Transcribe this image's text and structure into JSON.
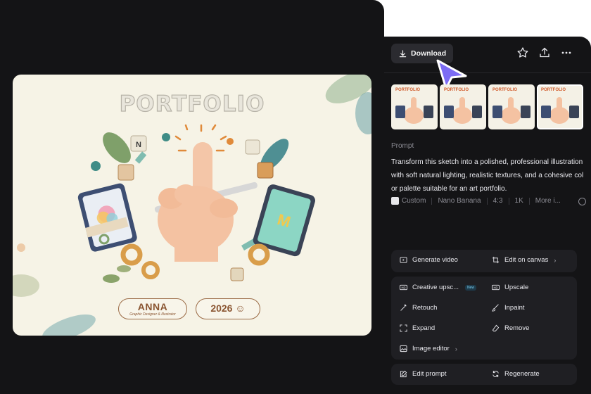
{
  "preview": {
    "title": "PORTFOLIO",
    "name": "ANNA",
    "subtitle": "Graphic Designer & Illustrator",
    "year": "2026"
  },
  "toolbar": {
    "download_label": "Download"
  },
  "thumbnails": [
    {
      "label": "PORTFOLIO"
    },
    {
      "label": "PORTFOLIO"
    },
    {
      "label": "PORTFOLIO"
    },
    {
      "label": "PORTFOLIO"
    }
  ],
  "prompt": {
    "label": "Prompt",
    "text": "Transform this sketch into a polished, professional illustration with soft natural lighting, realistic textures, and a cohesive color palette suitable for an art portfolio.",
    "style": "Custom",
    "model": "Nano Banana",
    "ratio": "4:3",
    "resolution": "1K",
    "more": "More i..."
  },
  "actions": {
    "generate_video": "Generate video",
    "edit_on_canvas": "Edit on canvas",
    "creative_upscale": "Creative upsc...",
    "new_badge": "New",
    "upscale": "Upscale",
    "retouch": "Retouch",
    "inpaint": "Inpaint",
    "expand": "Expand",
    "remove": "Remove",
    "image_editor": "Image editor",
    "edit_prompt": "Edit prompt",
    "regenerate": "Regenerate"
  },
  "colors": {
    "panel_bg": "#141416",
    "group_bg": "#1f1f23",
    "cursor": "#7c6cf5"
  }
}
